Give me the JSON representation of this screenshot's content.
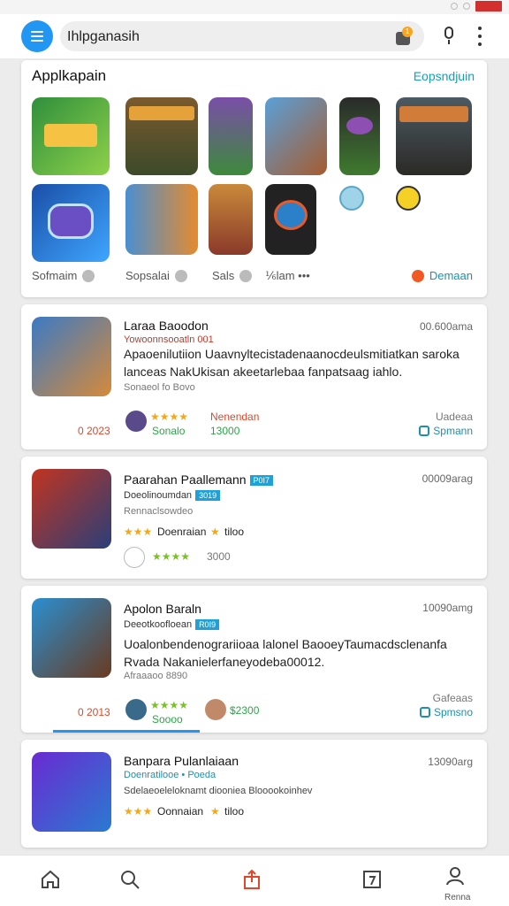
{
  "search": {
    "query": "Ihlpganasih",
    "badge_count": "1"
  },
  "section": {
    "title": "Applkapain",
    "link": "Eopsndjuin",
    "footer": [
      "Sofmaim",
      "Sopsalai",
      "Sals",
      "⅙lam •••"
    ],
    "action": "Demaan"
  },
  "items": [
    {
      "title": "Laraa Baoodon",
      "subtitle": "Yowoonnsooatln 001",
      "desc": "Apaoenilutiion Uaavnyltecistadenaanocdeulsmitiatkan saroka lanceas NakUkisan akeetarlebaa fanpatsaag iahlo.",
      "meta": "Sonaeol fo Bovo",
      "time": "00.600ama",
      "price": "0 2023",
      "extra1": "Sonalo",
      "extra2": "Nenendan",
      "extra3": "13000",
      "status": "Uadeaa",
      "action": "Spmann"
    },
    {
      "title": "Paarahan Paallemann",
      "tag": "P0I7",
      "subtitle": "Doeolinoumdan",
      "subtag": "3019",
      "meta": "Rennaclsowdeo",
      "time": "00009arag",
      "extra1": "Doenraian",
      "extra2": "tiloo",
      "extra3": "3000"
    },
    {
      "title": "Apolon Baraln",
      "tag": "R0I9",
      "subtitle": "Deeotkoofloean",
      "desc": "Uoalonbendenograriioaa lalonel BaooeyTaumacdsclenanfa Rvada Nakanielerfaneyodeba00012.",
      "meta": "Afraaaoo 8890",
      "time": "10090amg",
      "price": "0 2013",
      "extra1": "Soooo",
      "extra3": "$2300",
      "status": "Gafeaas",
      "action": "Spmsno"
    },
    {
      "title": "Banpara Pulanlaiaan",
      "subtitle": "Doenratilooe • Poeda",
      "meta": "Sdelaeoeleloknamt diooniea Blooookoinhev",
      "time": "13090arg",
      "extra1": "Oonnaian",
      "extra2": "tiloo"
    }
  ],
  "nav": {
    "profile_label": "Renna"
  },
  "colors": {
    "accent": "#2196f3",
    "link": "#14a0b8",
    "orange": "#e0472a",
    "green": "#28a745",
    "star": "#f2a81b"
  },
  "icons": [
    "menu-icon",
    "bag-icon",
    "mic-icon",
    "more-vert-icon",
    "home-icon",
    "search-icon",
    "share-icon",
    "calendar-icon",
    "profile-icon"
  ]
}
